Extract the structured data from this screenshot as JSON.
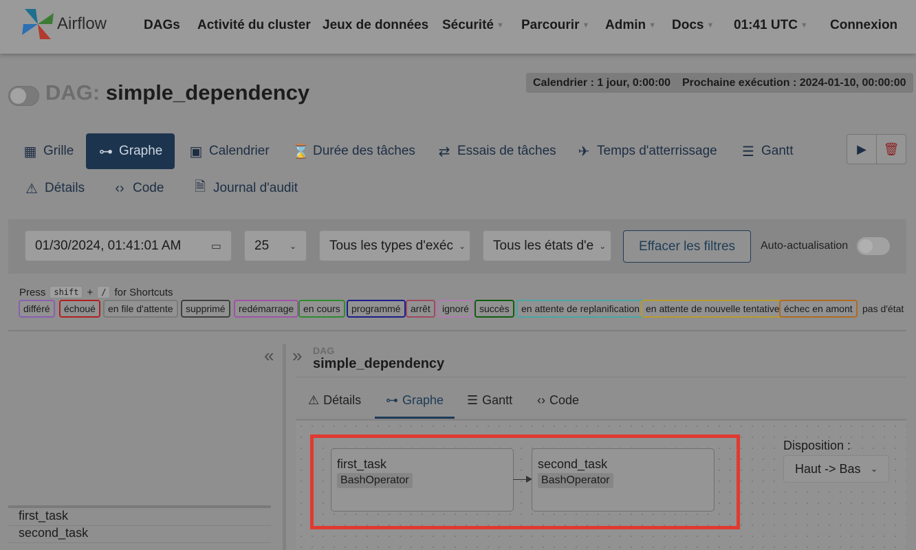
{
  "navbar": {
    "brand": "Airflow",
    "items": [
      {
        "label": "DAGs",
        "dropdown": false
      },
      {
        "label": "Activité du cluster",
        "dropdown": false
      },
      {
        "label": "Jeux de données",
        "dropdown": false
      },
      {
        "label": "Sécurité",
        "dropdown": true
      },
      {
        "label": "Parcourir",
        "dropdown": true
      },
      {
        "label": "Admin",
        "dropdown": true
      },
      {
        "label": "Docs",
        "dropdown": true
      },
      {
        "label": "01:41 UTC",
        "dropdown": true
      },
      {
        "label": "Connexion",
        "dropdown": false
      }
    ]
  },
  "dag": {
    "prefix": "DAG:",
    "name": "simple_dependency",
    "schedule": "Calendrier : 1 jour, 0:00:00",
    "next_run": "Prochaine exécution : 2024-01-10, 00:00:00"
  },
  "views": [
    {
      "label": "Grille",
      "icon": "grid-icon",
      "active": false
    },
    {
      "label": "Graphe",
      "icon": "graph-icon",
      "active": true
    },
    {
      "label": "Calendrier",
      "icon": "calendar-icon",
      "active": false
    },
    {
      "label": "Durée des tâches",
      "icon": "hourglass-icon",
      "active": false
    },
    {
      "label": "Essais de tâches",
      "icon": "repeat-icon",
      "active": false
    },
    {
      "label": "Temps d'atterrissage",
      "icon": "plane-landing-icon",
      "active": false
    },
    {
      "label": "Gantt",
      "icon": "gantt-icon",
      "active": false
    },
    {
      "label": "Détails",
      "icon": "warning-triangle-icon",
      "active": false
    },
    {
      "label": "Code",
      "icon": "code-icon",
      "active": false
    },
    {
      "label": "Journal d'audit",
      "icon": "audit-log-icon",
      "active": false
    }
  ],
  "filters": {
    "datetime": "01/30/2024, 01:41:01 AM",
    "num_runs": "25",
    "run_type": "Tous les types d'exéc",
    "run_state": "Tous les états d'e",
    "clear_label": "Effacer les filtres",
    "auto_refresh_label": "Auto-actualisation"
  },
  "shortcuts": {
    "press": "Press",
    "key1": "shift",
    "plus": "+",
    "key2": "/",
    "suffix": "for Shortcuts"
  },
  "legend": [
    {
      "label": "différé",
      "color": "#8a5fb0"
    },
    {
      "label": "échoué",
      "color": "#b02020"
    },
    {
      "label": "en file d'attente",
      "color": "#7a7a7a"
    },
    {
      "label": "supprimé",
      "color": "#3f3f3f"
    },
    {
      "label": "redémarrage",
      "color": "#a052a8"
    },
    {
      "label": "en cours",
      "color": "#2e8a2e"
    },
    {
      "label": "programmé",
      "color": "#1c1c8c"
    },
    {
      "label": "arrêt",
      "color": "#a04860"
    },
    {
      "label": "ignoré",
      "color": "#b07ab0"
    },
    {
      "label": "succès",
      "color": "#105e10"
    },
    {
      "label": "en attente de replanification",
      "color": "#4aa6a6"
    },
    {
      "label": "en attente de nouvelle tentative",
      "color": "#b89a2c"
    },
    {
      "label": "échec en amont",
      "color": "#b06a22"
    },
    {
      "label": "pas d'état",
      "color": ""
    }
  ],
  "tasks": [
    "first_task",
    "second_task"
  ],
  "details_panel": {
    "kicker": "DAG",
    "title": "simple_dependency",
    "tabs": [
      {
        "label": "Détails",
        "icon": "warning-triangle-icon",
        "active": false
      },
      {
        "label": "Graphe",
        "icon": "graph-icon",
        "active": true
      },
      {
        "label": "Gantt",
        "icon": "gantt-icon",
        "active": false
      },
      {
        "label": "Code",
        "icon": "code-icon",
        "active": false
      }
    ]
  },
  "graph": {
    "nodes": [
      {
        "name": "first_task",
        "operator": "BashOperator"
      },
      {
        "name": "second_task",
        "operator": "BashOperator"
      }
    ],
    "layout_label": "Disposition :",
    "layout_value": "Haut -> Bas"
  },
  "colors": {
    "active_tab": "#1c344e",
    "highlight": "#e03a30"
  }
}
